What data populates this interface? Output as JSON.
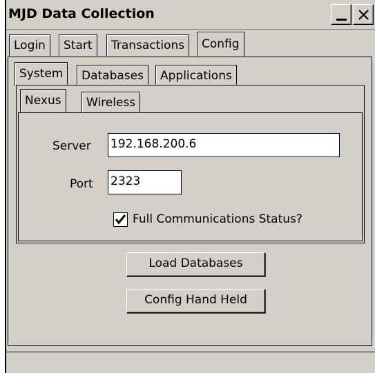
{
  "window": {
    "title": "MJD Data Collection"
  },
  "top_tabs": [
    "Login",
    "Start",
    "Transactions",
    "Config"
  ],
  "config_tabs": [
    "System",
    "Databases",
    "Applications"
  ],
  "system_tabs": [
    "Nexus",
    "Wireless"
  ],
  "nexus": {
    "server_label": "Server",
    "server_value": "192.168.200.6",
    "port_label": "Port",
    "port_value": "2323",
    "full_status_label": "Full Communications Status?",
    "full_status_checked": true
  },
  "actions": {
    "load_databases": "Load Databases",
    "config_hand_held": "Config Hand Held"
  }
}
